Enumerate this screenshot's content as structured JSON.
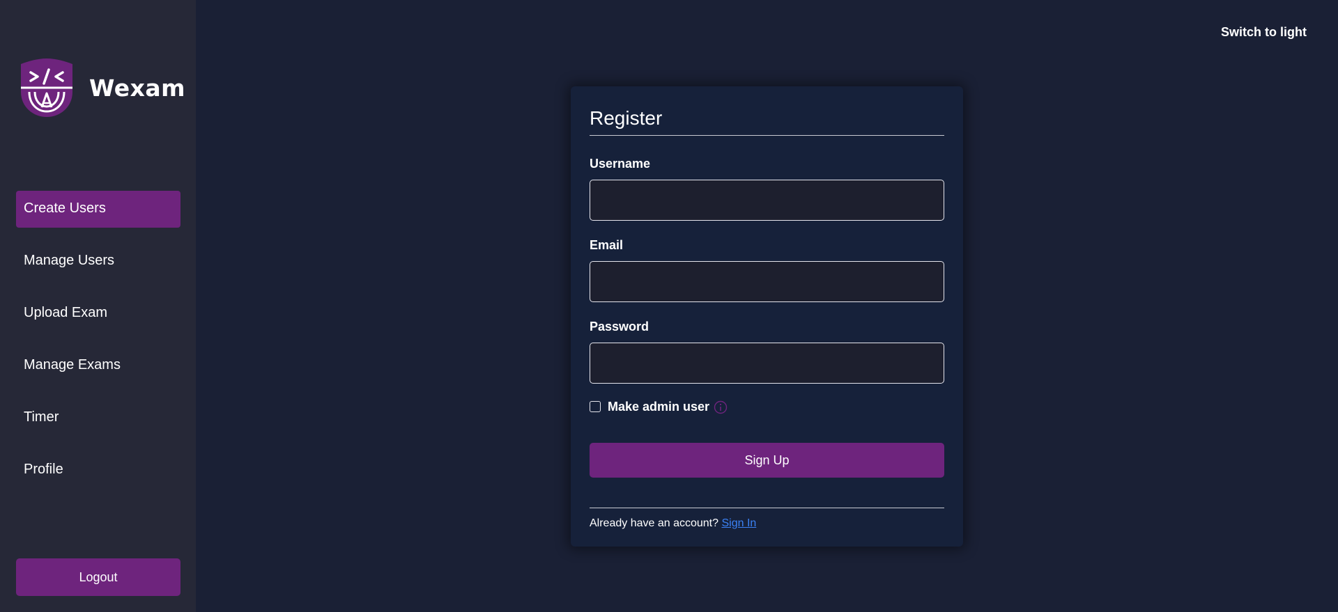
{
  "brand": {
    "name": "Wexam",
    "logo_icon": "shield-code-logo",
    "logo_color": "#6e247d"
  },
  "sidebar": {
    "items": [
      {
        "label": "Create Users",
        "active": true
      },
      {
        "label": "Manage Users",
        "active": false
      },
      {
        "label": "Upload Exam",
        "active": false
      },
      {
        "label": "Manage Exams",
        "active": false
      },
      {
        "label": "Timer",
        "active": false
      },
      {
        "label": "Profile",
        "active": false
      }
    ],
    "logout_label": "Logout"
  },
  "header": {
    "theme_toggle_label": "Switch to light"
  },
  "form": {
    "title": "Register",
    "username": {
      "label": "Username",
      "value": "",
      "placeholder": ""
    },
    "email": {
      "label": "Email",
      "value": "",
      "placeholder": ""
    },
    "password": {
      "label": "Password",
      "value": "",
      "placeholder": ""
    },
    "admin_checkbox": {
      "label": "Make admin user",
      "checked": false,
      "info_icon": "info-icon"
    },
    "submit_label": "Sign Up",
    "footer_text": "Already have an account?",
    "signin_link": "Sign In"
  },
  "colors": {
    "accent": "#6e247d",
    "background": "#1a2035",
    "sidebar": "#262837",
    "card": "#16213a",
    "link": "#3b82f6"
  }
}
